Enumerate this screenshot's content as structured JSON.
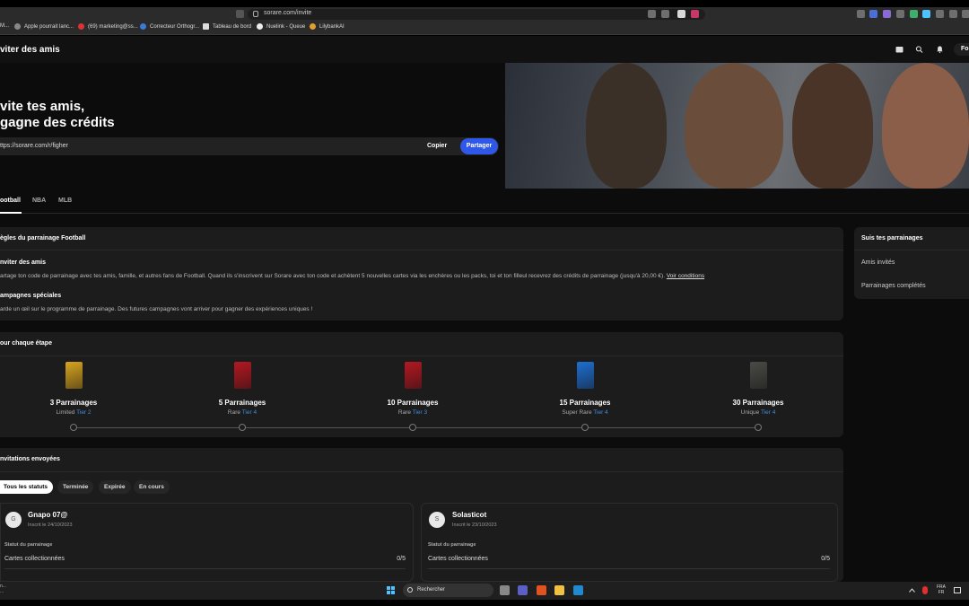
{
  "browser": {
    "url": "sorare.com/invite",
    "bookmarks": [
      {
        "label": "M..."
      },
      {
        "label": "Apple pourrait lanc..."
      },
      {
        "label": "(69) marketing@ss..."
      },
      {
        "label": "Correcteur Orthogr..."
      },
      {
        "label": "Tableau de bord"
      },
      {
        "label": "Nuelink - Queue"
      },
      {
        "label": "LilybankAI"
      }
    ]
  },
  "header": {
    "title": "viter des amis",
    "avatar_initials": "Fo"
  },
  "hero": {
    "title_line1": "vite tes amis,",
    "title_line2": "gagne des crédits",
    "referral_link": "ttps://sorare.com/r/figher",
    "copy_label": "Copier",
    "share_label": "Partager"
  },
  "sports_tabs": [
    {
      "label": "ootball",
      "active": true
    },
    {
      "label": "NBA",
      "active": false
    },
    {
      "label": "MLB",
      "active": false
    }
  ],
  "rules": {
    "title": "ègles du parrainage Football",
    "invite_heading": "nviter des amis",
    "invite_text": "artage ton code de parrainage avec tes amis, famille, et autres fans de Football. Quand ils s'inscrivent sur Sorare avec ton code et achètent 5 nouvelles cartes via les enchères ou les packs, toi et ton filleul recevrez des crédits de parrainage (jusqu'à 20,00 €).",
    "terms_link": "Voir conditions",
    "campaigns_heading": "ampagnes spéciales",
    "campaigns_text": "arde un œil sur le programme de parrainage. Des futures campagnes vont arriver pour gagner des expériences uniques !"
  },
  "side_panel": {
    "title": "Suis tes parrainages",
    "items": [
      "Amis invités",
      "Parrainages complétés"
    ]
  },
  "tiers": {
    "title": "our chaque étape",
    "steps": [
      {
        "count": "3 Parrainages",
        "rarity": "Limited",
        "tier": "Tier 2",
        "color": "#d9a520"
      },
      {
        "count": "5 Parrainages",
        "rarity": "Rare",
        "tier": "Tier 4",
        "color": "#b51822"
      },
      {
        "count": "10 Parrainages",
        "rarity": "Rare",
        "tier": "Tier 3",
        "color": "#b51822"
      },
      {
        "count": "15 Parrainages",
        "rarity": "Super Rare",
        "tier": "Tier 4",
        "color": "#1f6fd1"
      },
      {
        "count": "30 Parrainages",
        "rarity": "Unique",
        "tier": "Tier 4",
        "color": "#4a4a46"
      }
    ]
  },
  "invitations": {
    "title": "nvitations envoyées",
    "filters": [
      {
        "label": "Tous les statuts",
        "active": true
      },
      {
        "label": "Terminée",
        "active": false
      },
      {
        "label": "Expirée",
        "active": false
      },
      {
        "label": "En cours",
        "active": false
      }
    ],
    "items": [
      {
        "initial": "G",
        "name": "Gnapo 07@",
        "date": "Inscrit le 24/10/2023",
        "status_label": "Statut du parrainage",
        "cards_label": "Cartes collectionnées",
        "cards_count": "0/5"
      },
      {
        "initial": "S",
        "name": "Solasticot",
        "date": "Inscrit le 23/10/2023",
        "status_label": "Statut du parrainage",
        "cards_label": "Cartes collectionnées",
        "cards_count": "0/5"
      }
    ]
  },
  "taskbar": {
    "left_line1": "n...",
    "left_line2": "...",
    "search_placeholder": "Rechercher",
    "lang_line1": "FRA",
    "lang_line2": "FR"
  },
  "colors": {
    "accent": "#2f57e8",
    "tier_link": "#3d8fe0",
    "card_bg": "#1c1c1c"
  }
}
